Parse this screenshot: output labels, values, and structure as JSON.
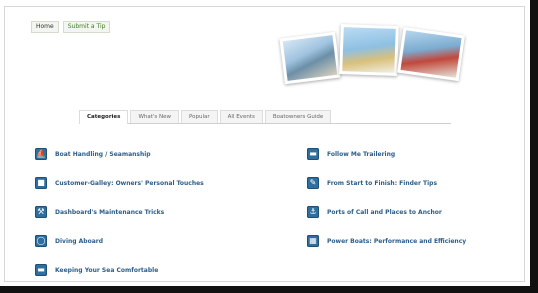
{
  "topnav": {
    "home": "Home",
    "submit": "Submit a Tip"
  },
  "tabs": [
    "Categories",
    "What's New",
    "Popular",
    "All Events",
    "Boatowners Guide"
  ],
  "categories_left": [
    {
      "label": "Boat Handling / Seamanship",
      "icon": "boat-icon"
    },
    {
      "label": "Customer-Galley: Owners' Personal Touches",
      "icon": "galley-icon"
    },
    {
      "label": "Dashboard's Maintenance Tricks",
      "icon": "wrench-icon"
    },
    {
      "label": "Diving Aboard",
      "icon": "dive-icon"
    },
    {
      "label": "Keeping Your Sea Comfortable",
      "icon": "comfort-icon"
    }
  ],
  "categories_right": [
    {
      "label": "Follow Me Trailering",
      "icon": "trailer-icon"
    },
    {
      "label": "From Start to Finish: Finder Tips",
      "icon": "finder-icon"
    },
    {
      "label": "Ports of Call and Places to Anchor",
      "icon": "anchor-icon"
    },
    {
      "label": "Power Boats: Performance and Efficiency",
      "icon": "power-icon"
    }
  ],
  "colors": {
    "link": "#2b5d8a",
    "icon": "#2f6f9f",
    "tip": "#3e7c1f"
  }
}
